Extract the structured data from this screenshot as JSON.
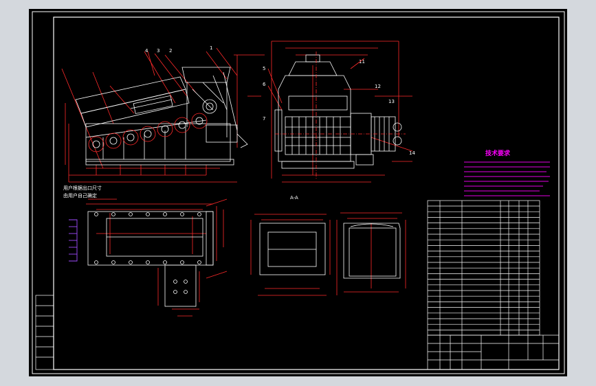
{
  "tech_requirements": {
    "title": "技术要求",
    "lines": [
      "",
      "",
      "",
      "",
      "",
      "",
      "",
      ""
    ]
  },
  "callouts": {
    "top_numbers": [
      "4",
      "3",
      "2",
      "1",
      "5",
      "6",
      "7"
    ],
    "side_numbers": [
      "11",
      "12",
      "13",
      "14"
    ]
  },
  "annotations": {
    "note_line1": "用户根据出口尺寸",
    "note_line2": "由用户自己确定",
    "view_label": "A-A"
  },
  "title_block": {
    "drawing_name": "",
    "scale": "",
    "sheet": ""
  },
  "colors": {
    "background": "#000000",
    "frame": "#ffffff",
    "dimension": "#ff2a2a",
    "outline": "#ffffff",
    "hidden": "#ff2a2a",
    "centerline": "#ff2a2a",
    "magenta": "#ff00ff",
    "page": "#d4d8dd"
  }
}
